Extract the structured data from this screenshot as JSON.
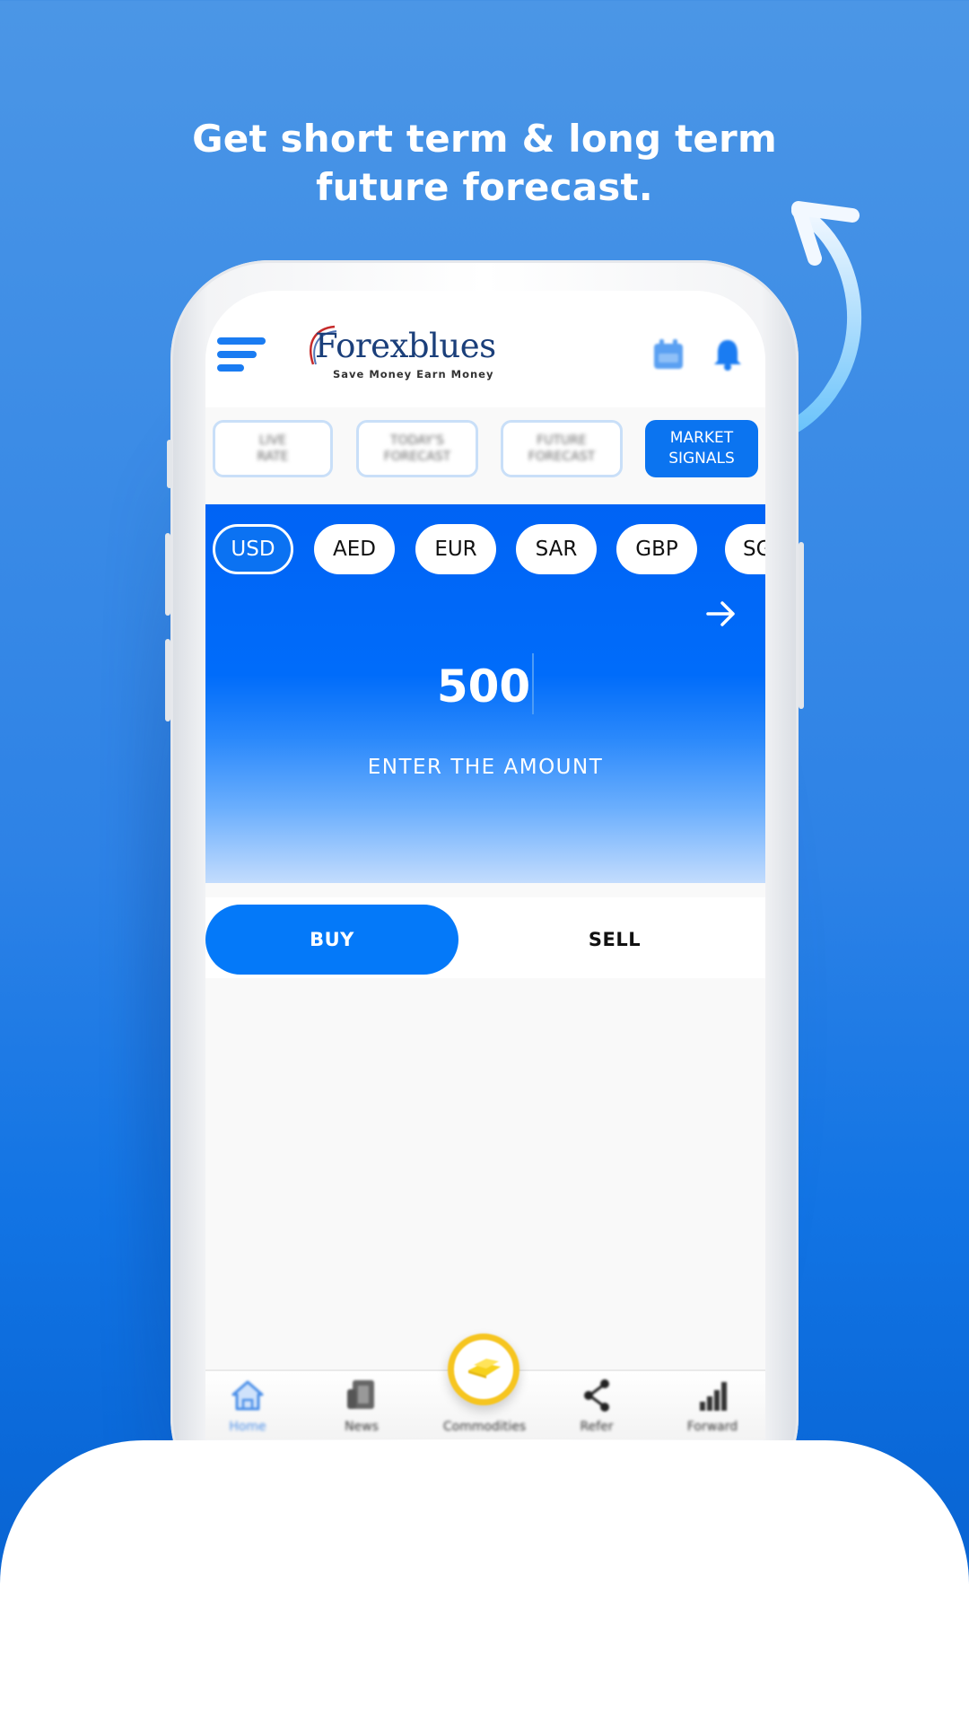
{
  "headline": {
    "line1": "Get short term & long term",
    "line2": "future forecast."
  },
  "colors": {
    "background": "#3c8ce6",
    "accent": "#0b74f0",
    "panel_blue": "#006cfa",
    "gold": "#f6c520"
  },
  "app": {
    "logo": {
      "brand": "Forexblues",
      "tagline": "Save Money Earn Money"
    },
    "header_icons": [
      "menu-icon",
      "calendar-icon",
      "bell-icon"
    ],
    "tabs": [
      {
        "label": "LIVE\nRATE",
        "active": false
      },
      {
        "label": "TODAY'S\nFORECAST",
        "active": false
      },
      {
        "label": "FUTURE\nFORECAST",
        "active": false
      },
      {
        "label": "MARKET\nSIGNALS",
        "active": true
      }
    ],
    "currencies": [
      {
        "code": "USD",
        "active": true
      },
      {
        "code": "AED",
        "active": false
      },
      {
        "code": "EUR",
        "active": false
      },
      {
        "code": "SAR",
        "active": false
      },
      {
        "code": "GBP",
        "active": false
      },
      {
        "code": "SG",
        "active": false
      }
    ],
    "amount": {
      "value": "500",
      "label": "ENTER THE AMOUNT"
    },
    "trade": {
      "buy_label": "BUY",
      "sell_label": "SELL",
      "selected": "BUY"
    },
    "bottom_nav": [
      {
        "label": "Home",
        "icon": "home-icon",
        "active": true
      },
      {
        "label": "News",
        "icon": "news-icon",
        "active": false
      },
      {
        "label": "Commodities",
        "icon": "gold-bars-icon",
        "active": false
      },
      {
        "label": "Refer",
        "icon": "share-icon",
        "active": false
      },
      {
        "label": "Forward",
        "icon": "bar-chart-icon",
        "active": false
      }
    ]
  }
}
